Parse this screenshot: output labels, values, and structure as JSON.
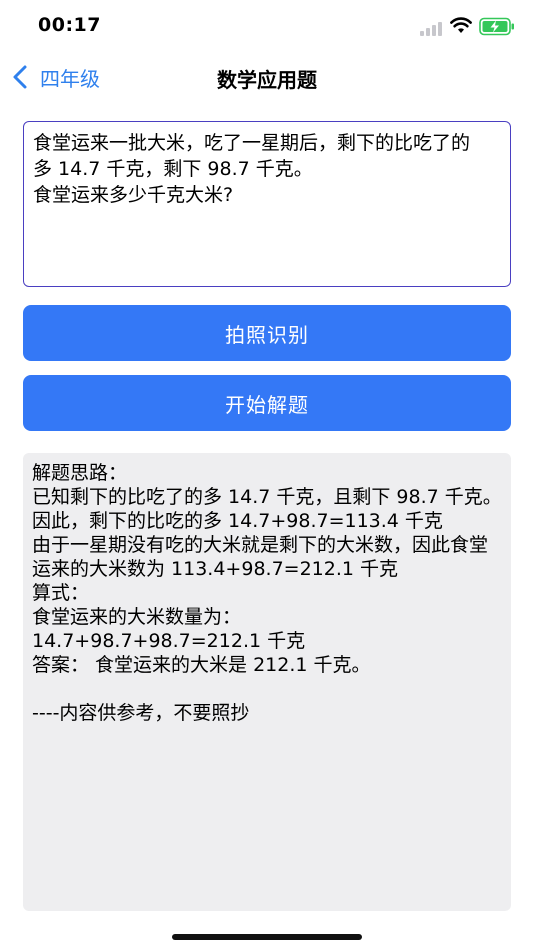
{
  "status_bar": {
    "time": "00:17"
  },
  "nav": {
    "back_label": "四年级",
    "title": "数学应用题"
  },
  "question": {
    "text": "食堂运来一批大米，吃了一星期后，剩下的比吃了的\n多 14.7 千克，剩下 98.7 千克。\n食堂运来多少千克大米?"
  },
  "buttons": {
    "photo_label": "拍照识别",
    "solve_label": "开始解题"
  },
  "answer": {
    "text": "解题思路：\n已知剩下的比吃了的多 14.7 千克，且剩下 98.7 千克。因此，剩下的比吃的多 14.7+98.7=113.4 千克\n由于一星期没有吃的大米就是剩下的大米数，因此食堂运来的大米数为 113.4+98.7=212.1 千克\n算式：\n食堂运来的大米数量为：\n14.7+98.7+98.7=212.1 千克\n答案： 食堂运来的大米是 212.1 千克。\n\n----内容供参考，不要照抄"
  },
  "colors": {
    "accent": "#3478f6",
    "back_link": "#2f80ed",
    "question_border": "#4a3fc1",
    "answer_bg": "#eeeef0",
    "battery_fill": "#34c759"
  }
}
